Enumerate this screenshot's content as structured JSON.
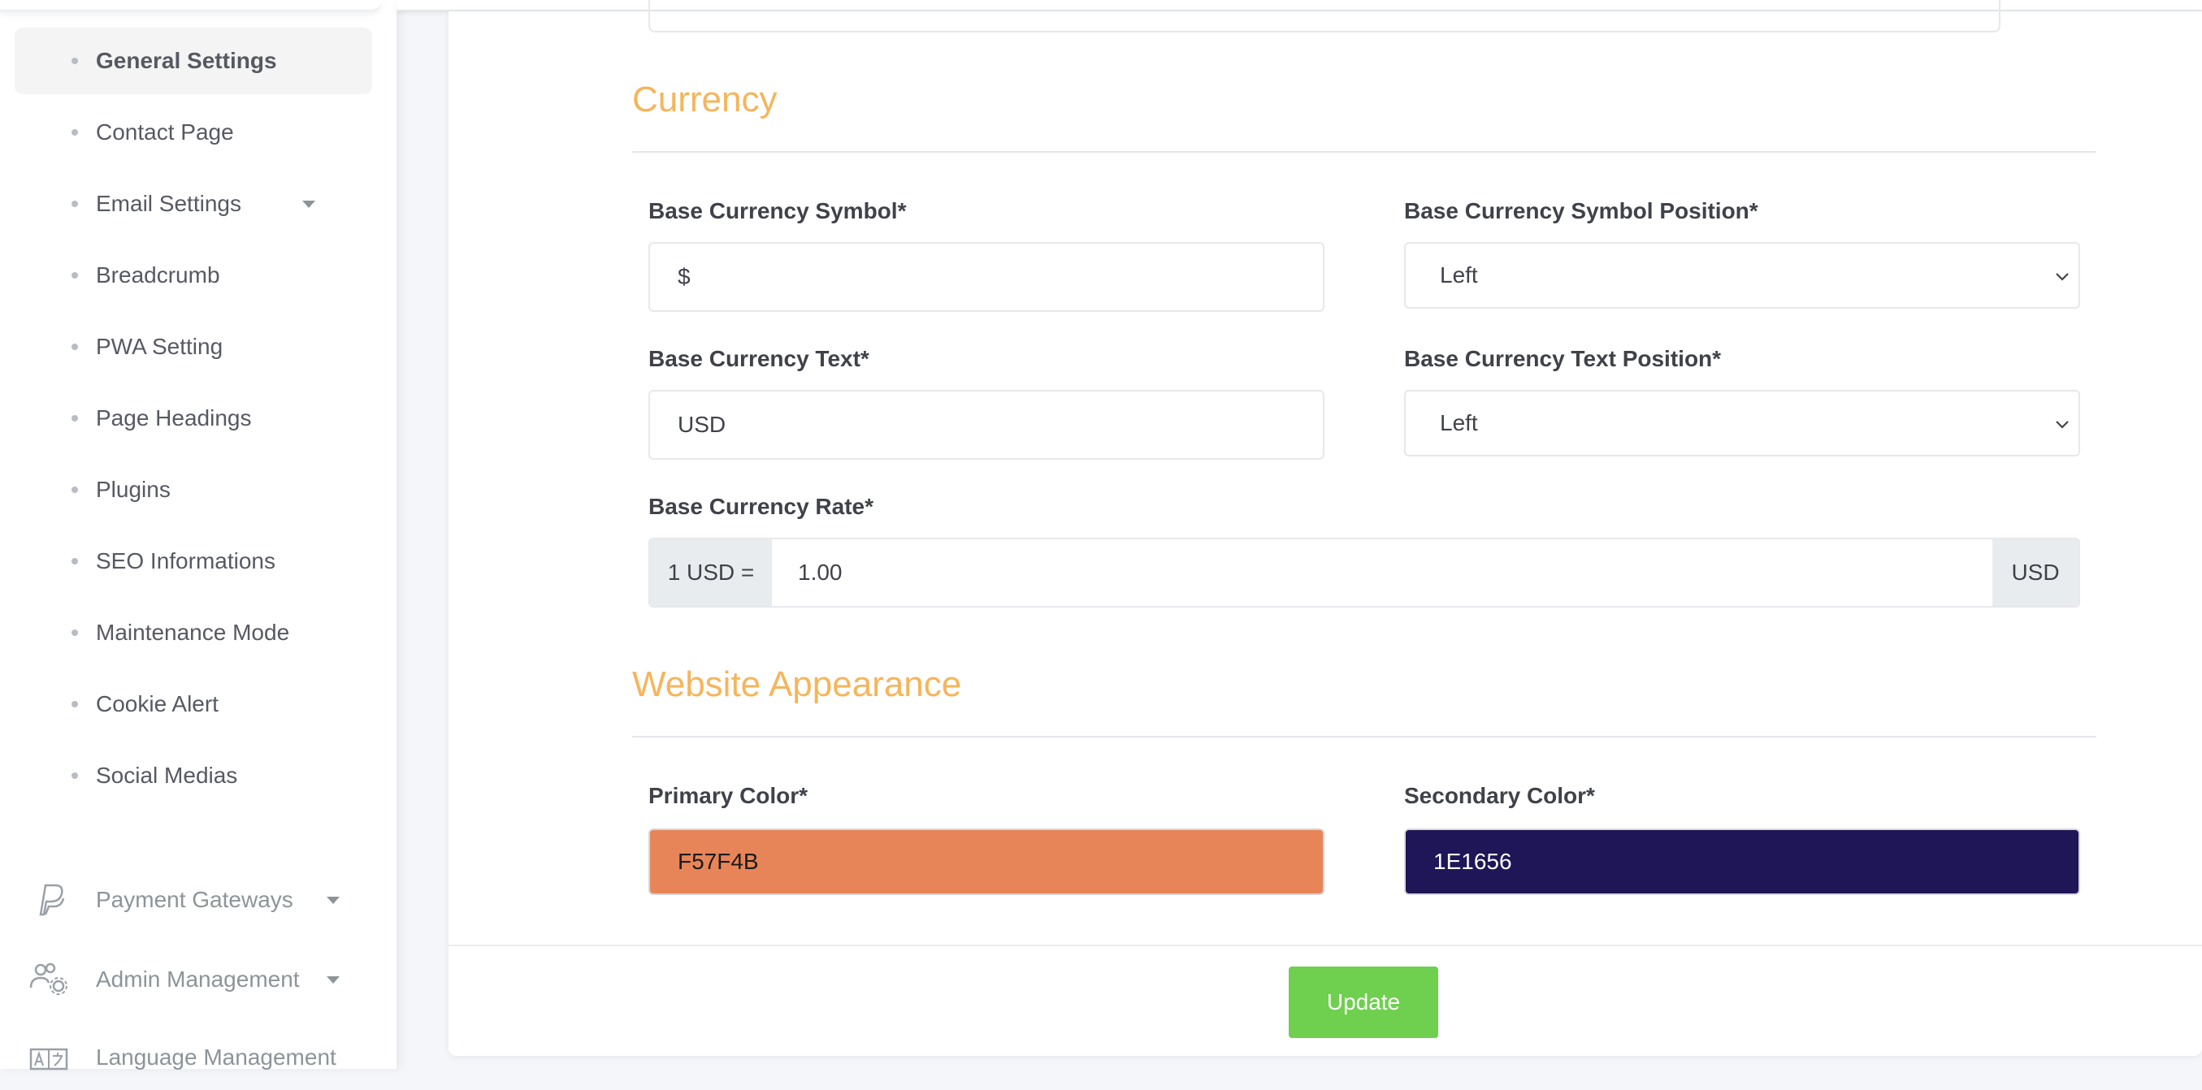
{
  "sidebar": {
    "settings_items": [
      {
        "label": "General Settings",
        "active": true
      },
      {
        "label": "Contact Page"
      },
      {
        "label": "Email Settings",
        "has_submenu": true
      },
      {
        "label": "Breadcrumb"
      },
      {
        "label": "PWA Setting"
      },
      {
        "label": "Page Headings"
      },
      {
        "label": "Plugins"
      },
      {
        "label": "SEO Informations"
      },
      {
        "label": "Maintenance Mode"
      },
      {
        "label": "Cookie Alert"
      },
      {
        "label": "Social Medias"
      }
    ],
    "main_items": [
      {
        "label": "Payment Gateways",
        "icon": "paypal-icon"
      },
      {
        "label": "Admin Management",
        "icon": "users-cog-icon"
      },
      {
        "label": "Language Management",
        "icon": "language-icon"
      }
    ]
  },
  "currency": {
    "title": "Currency",
    "symbol_label": "Base Currency Symbol*",
    "symbol_value": "$",
    "symbol_position_label": "Base Currency Symbol Position*",
    "symbol_position_value": "Left",
    "text_label": "Base Currency Text*",
    "text_value": "USD",
    "text_position_label": "Base Currency Text Position*",
    "text_position_value": "Left",
    "rate_label": "Base Currency Rate*",
    "rate_prefix": "1 USD =",
    "rate_value": "1.00",
    "rate_suffix": "USD"
  },
  "appearance": {
    "title": "Website Appearance",
    "primary_label": "Primary Color*",
    "primary_value": "F57F4B",
    "primary_color": "#e88558",
    "secondary_label": "Secondary Color*",
    "secondary_value": "1E1656",
    "secondary_color": "#1e1656"
  },
  "footer": {
    "update_label": "Update",
    "update_color": "#6fcf4f"
  },
  "colors": {
    "accent": "#f5b55c"
  }
}
